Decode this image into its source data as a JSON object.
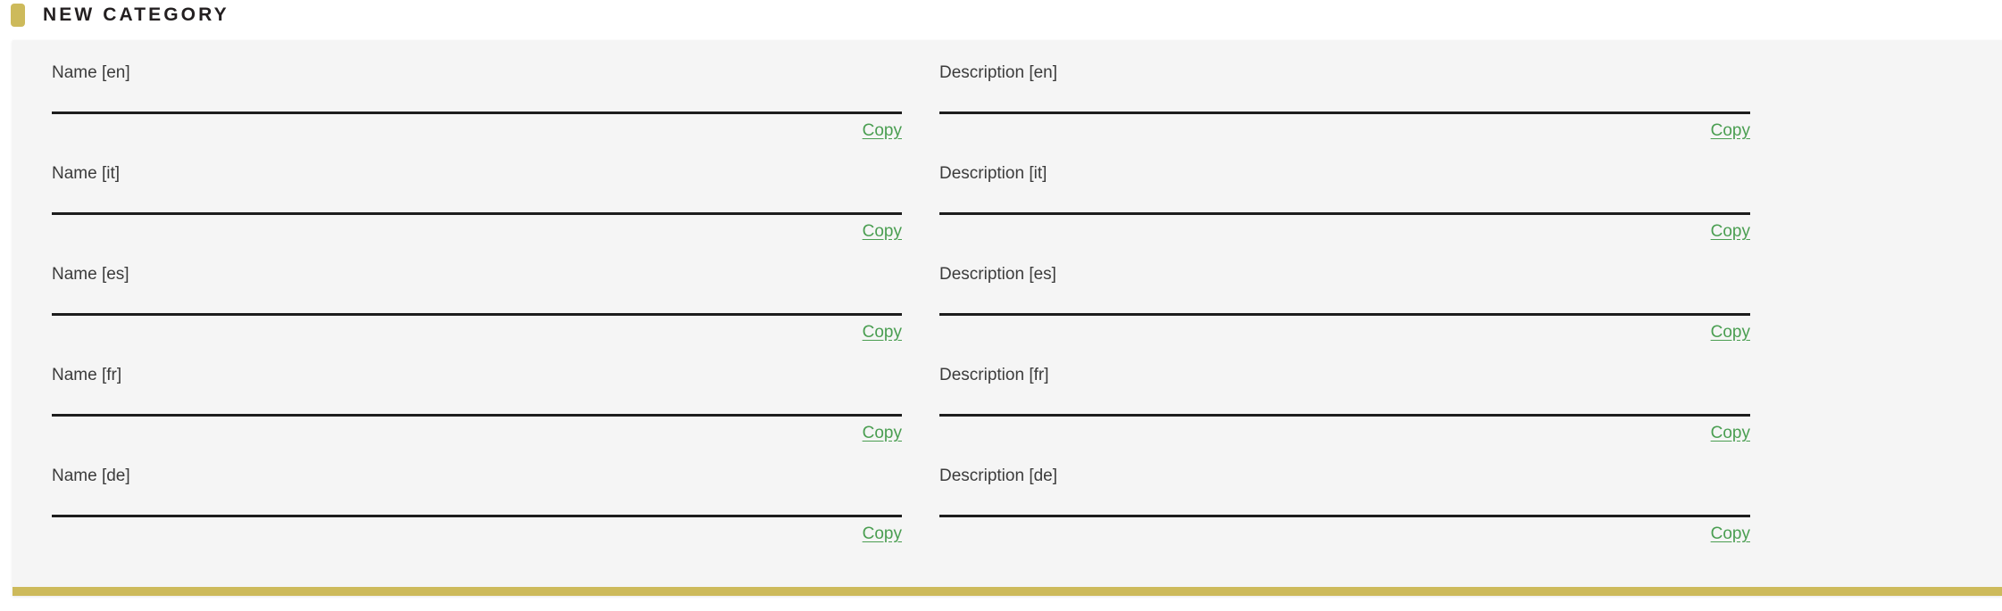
{
  "header": {
    "title": "NEW CATEGORY",
    "accent_color": "#cdba5b",
    "swatch_icon": "category-color-swatch"
  },
  "card": {
    "background_color": "#f5f5f5",
    "bottom_accent_color": "#cdba5b"
  },
  "link_color": "#4a9e51",
  "copy_label": "Copy",
  "columns": [
    {
      "key": "name",
      "fields": [
        {
          "label": "Name [en]",
          "lang": "en",
          "value": "",
          "placeholder": "",
          "copy_label": "Copy"
        },
        {
          "label": "Name [it]",
          "lang": "it",
          "value": "",
          "placeholder": "",
          "copy_label": "Copy"
        },
        {
          "label": "Name [es]",
          "lang": "es",
          "value": "",
          "placeholder": "",
          "copy_label": "Copy"
        },
        {
          "label": "Name [fr]",
          "lang": "fr",
          "value": "",
          "placeholder": "",
          "copy_label": "Copy"
        },
        {
          "label": "Name [de]",
          "lang": "de",
          "value": "",
          "placeholder": "",
          "copy_label": "Copy"
        }
      ]
    },
    {
      "key": "description",
      "fields": [
        {
          "label": "Description [en]",
          "lang": "en",
          "value": "",
          "placeholder": "",
          "copy_label": "Copy"
        },
        {
          "label": "Description [it]",
          "lang": "it",
          "value": "",
          "placeholder": "",
          "copy_label": "Copy"
        },
        {
          "label": "Description [es]",
          "lang": "es",
          "value": "",
          "placeholder": "",
          "copy_label": "Copy"
        },
        {
          "label": "Description [fr]",
          "lang": "fr",
          "value": "",
          "placeholder": "",
          "copy_label": "Copy"
        },
        {
          "label": "Description [de]",
          "lang": "de",
          "value": "",
          "placeholder": "",
          "copy_label": "Copy"
        }
      ]
    }
  ]
}
